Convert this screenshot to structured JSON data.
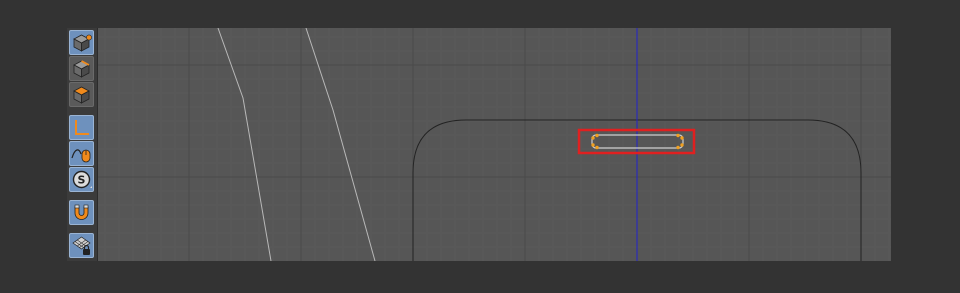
{
  "app": {
    "view": "2D viewport"
  },
  "colors": {
    "background": "#333333",
    "viewport": "#565656",
    "toolbar": "#3b3b3b",
    "grid_major": "#4a4a4a",
    "grid_minor": "#5c5c5c",
    "axis_line": "#2222cc",
    "selection_box": "#e02020",
    "handle": "#f0a020",
    "tool_active": "#6e91bd"
  },
  "toolbar": {
    "tools": [
      {
        "icon": "cube-vertex-icon",
        "state": "active"
      },
      {
        "icon": "cube-edge-icon",
        "state": "idle"
      },
      {
        "icon": "cube-face-icon",
        "state": "idle"
      },
      {
        "icon": "axis-angle-icon",
        "state": "active"
      },
      {
        "icon": "spline-mouse-icon",
        "state": "active"
      },
      {
        "icon": "snap-s-icon",
        "state": "active"
      },
      {
        "icon": "magnet-icon",
        "state": "active"
      },
      {
        "icon": "grid-lock-icon",
        "state": "active"
      }
    ]
  },
  "viewport": {
    "selected_object": "rectangle-spline"
  }
}
